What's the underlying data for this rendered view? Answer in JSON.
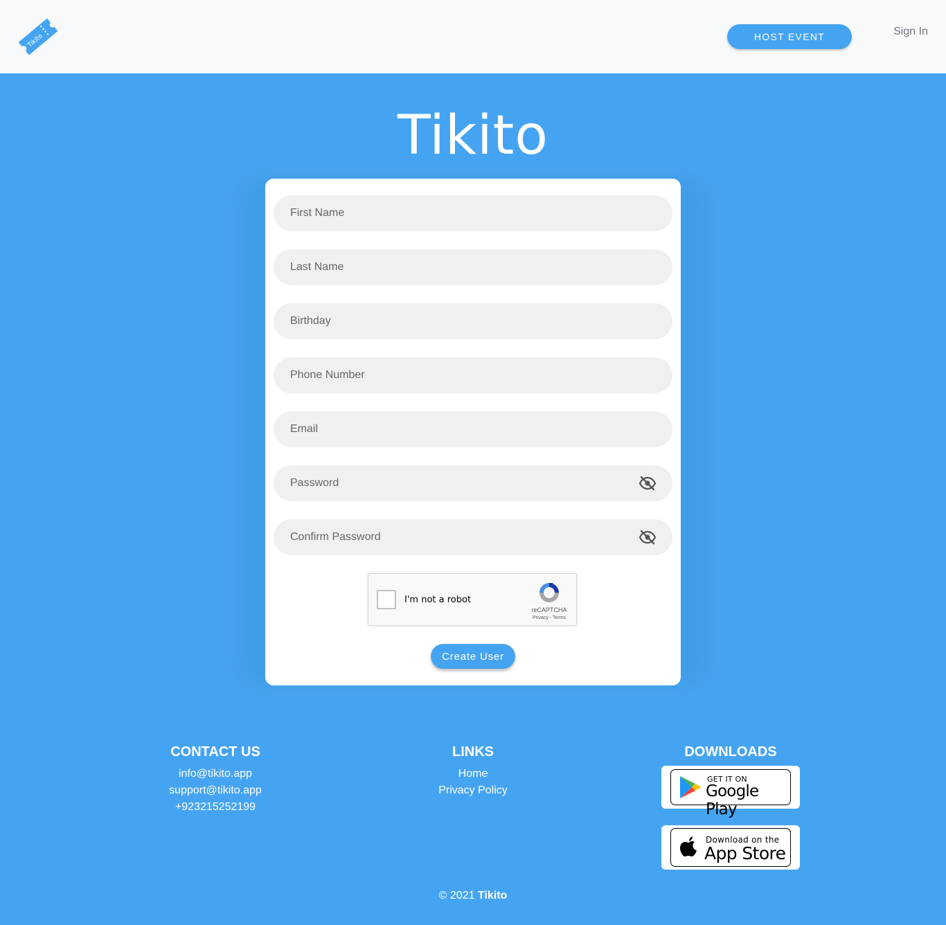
{
  "header": {
    "logo_text": "Tikito",
    "host_event_label": "HOST EVENT",
    "sign_in_label": "Sign In"
  },
  "brand": {
    "title": "Tikito"
  },
  "form": {
    "fields": [
      {
        "placeholder": "First Name",
        "type": "text"
      },
      {
        "placeholder": "Last Name",
        "type": "text"
      },
      {
        "placeholder": "Birthday",
        "type": "text"
      },
      {
        "placeholder": "Phone Number",
        "type": "text"
      },
      {
        "placeholder": "Email",
        "type": "text"
      },
      {
        "placeholder": "Password",
        "type": "password",
        "icon": "eye-off-icon"
      },
      {
        "placeholder": "Confirm Password",
        "type": "password",
        "icon": "eye-off-icon"
      }
    ],
    "captcha": {
      "label": "I'm not a robot",
      "brand": "reCAPTCHA",
      "links": "Privacy - Terms"
    },
    "submit_label": "Create User"
  },
  "footer": {
    "contact": {
      "heading": "CONTACT US",
      "items": [
        "info@tikito.app",
        "support@tikito.app",
        "+923215252199"
      ]
    },
    "links": {
      "heading": "LINKS",
      "items": [
        "Home",
        "Privacy Policy"
      ]
    },
    "downloads": {
      "heading": "DOWNLOADS",
      "google_play": {
        "small": "GET IT ON",
        "big": "Google Play"
      },
      "app_store": {
        "small": "Download on the",
        "big": "App Store"
      }
    },
    "copyright_prefix": "© 2021",
    "copyright_brand": "Tikito"
  },
  "colors": {
    "primary": "#45a4f2",
    "header_bg": "#f8f9fa",
    "field_bg": "#f0f0f0"
  }
}
